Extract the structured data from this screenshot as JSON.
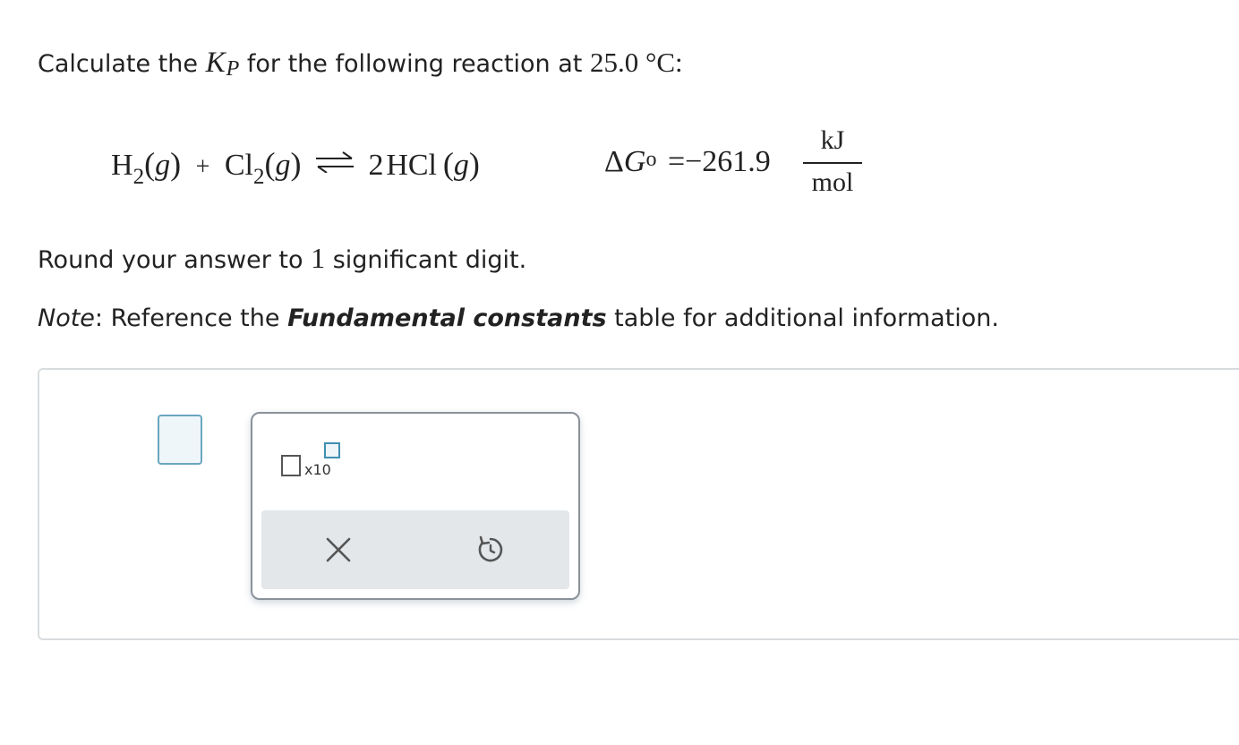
{
  "question": {
    "prefix": "Calculate the",
    "k_symbol": "K",
    "k_subscript": "P",
    "middle": "for the following reaction at",
    "temperature": "25.0 °C:"
  },
  "reaction": {
    "h2": "H",
    "h2_sub": "2",
    "phase_g": "g",
    "plus": "+",
    "cl2": "Cl",
    "cl2_sub": "2",
    "coefficient": "2",
    "hcl": "HCl"
  },
  "gibbs": {
    "delta": "Δ",
    "symbol": "G",
    "superscript": "o",
    "equals": "=",
    "value": "−261.9",
    "unit_numerator": "kJ",
    "unit_denominator": "mol"
  },
  "instructions": {
    "round_prefix": "Round your answer to",
    "round_digits": "1",
    "round_suffix": "significant digit.",
    "note_label": "Note",
    "note_colon": ":",
    "note_prefix": "Reference the",
    "note_bold": "Fundamental constants",
    "note_suffix": "table for additional information."
  },
  "palette": {
    "times_ten_label": "x10",
    "clear_icon": "x-icon",
    "undo_icon": "undo-icon"
  },
  "colors": {
    "input_border": "#6aa6c0",
    "input_fill": "#eef6fa",
    "action_bar": "#e3e7ea"
  }
}
